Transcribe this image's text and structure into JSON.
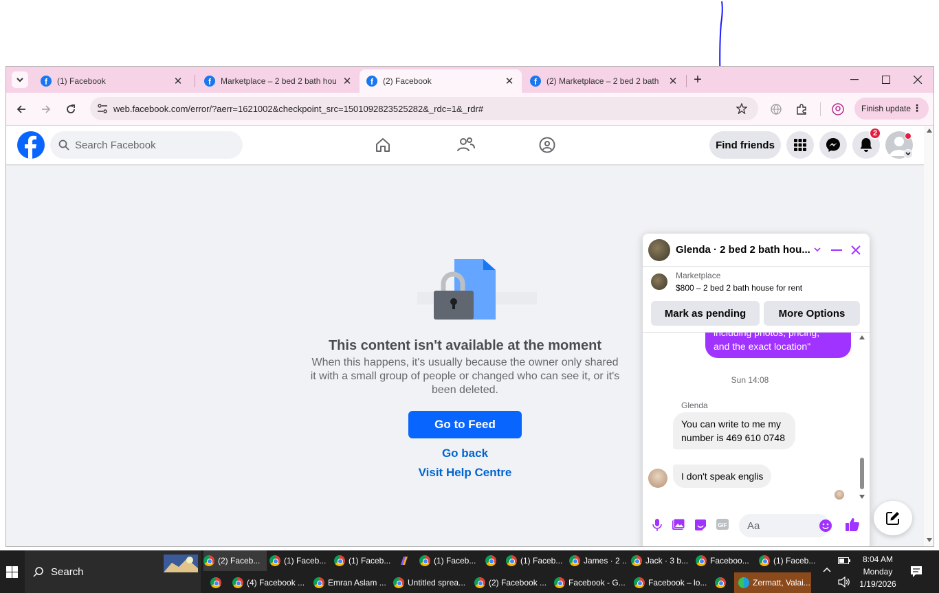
{
  "browser": {
    "tabs": [
      {
        "title": "(1) Facebook",
        "active": false
      },
      {
        "title": "Marketplace – 2 bed 2 bath hou",
        "active": false
      },
      {
        "title": "(2) Facebook",
        "active": true
      },
      {
        "title": "(2) Marketplace – 2 bed 2 bath",
        "active": false
      }
    ],
    "url": "web.facebook.com/error/?aerr=1621002&checkpoint_src=1501092823525282&_rdc=1&_rdr#",
    "finish_update": "Finish update"
  },
  "facebook": {
    "search_placeholder": "Search Facebook",
    "find_friends": "Find friends",
    "notification_count": "2"
  },
  "error": {
    "title": "This content isn't available at the moment",
    "description": "When this happens, it's usually because the owner only shared it with a small group of people or changed who can see it, or it's been deleted.",
    "go_to_feed": "Go to Feed",
    "go_back": "Go back",
    "help": "Visit Help Centre"
  },
  "chat": {
    "title": "Glenda · 2 bed 2 bath hou...",
    "marketplace_label": "Marketplace",
    "listing": "$800 – 2 bed 2 bath house for rent",
    "mark_pending": "Mark as pending",
    "more_options": "More Options",
    "sent_tail_line1": "including photos, pricing,",
    "sent_tail_line2": "and the exact location\"",
    "timestamp": "Sun 14:08",
    "sender_name": "Glenda",
    "msg1": "You can  write to me my number is 469 610 0748",
    "msg2": "I don't  speak englis",
    "input_placeholder": "Aa"
  },
  "taskbar": {
    "search": "Search",
    "row1": [
      "(2) Faceb...",
      "(1) Faceb...",
      "(1) Faceb...",
      "(1) Faceb...",
      "(1) Faceb...",
      "James · 2 ...",
      "Jack · 3 b...",
      "Faceboo...",
      "(1) Faceb..."
    ],
    "row2": [
      "(4) Facebook ...",
      "Emran Aslam ...",
      "Untitled sprea...",
      "(2) Facebook ...",
      "Facebook - G...",
      "Facebook – lo...",
      "Zermatt, Valai..."
    ],
    "time": "8:04 AM",
    "day": "Monday",
    "date": "1/19/2026"
  },
  "colors": {
    "fb_blue": "#0866ff",
    "messenger_purple": "#a033ff",
    "tab_strip": "#f6d3e6"
  }
}
